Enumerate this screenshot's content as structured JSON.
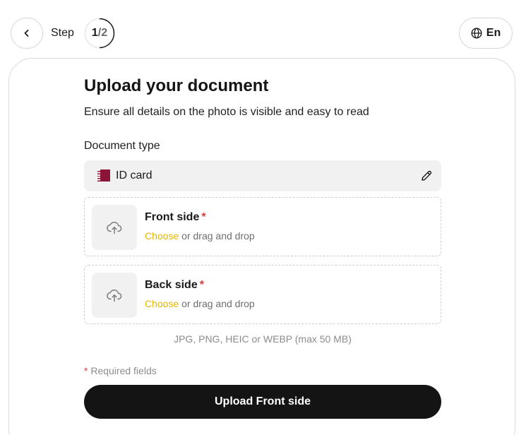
{
  "header": {
    "back_icon": "chevron-left-icon",
    "step_label": "Step",
    "step_current": "1",
    "step_separator": "/",
    "step_total": "2",
    "step_progress": 0.5,
    "language_icon": "globe-icon",
    "language_label": "En"
  },
  "form": {
    "title": "Upload your document",
    "subtitle": "Ensure all details on the photo is visible and easy to read",
    "document_type_label": "Document type",
    "document_type_value": "ID card",
    "document_type_flag": "qatar-flag-icon",
    "edit_icon": "pencil-icon",
    "uploads": [
      {
        "title": "Front side",
        "required_mark": "*",
        "choose_link": "Choose",
        "rest": " or drag and drop",
        "icon": "cloud-upload-icon"
      },
      {
        "title": "Back side",
        "required_mark": "*",
        "choose_link": "Choose",
        "rest": " or drag and drop",
        "icon": "cloud-upload-icon"
      }
    ],
    "formats_note": "JPG, PNG, HEIC or WEBP (max 50 MB)",
    "required_star": "*",
    "required_note": " Required fields",
    "submit_label": "Upload Front side"
  },
  "colors": {
    "accent_link": "#e5b800",
    "required": "#e03a3a",
    "button_bg": "#141414",
    "flag": "#8a1538"
  }
}
